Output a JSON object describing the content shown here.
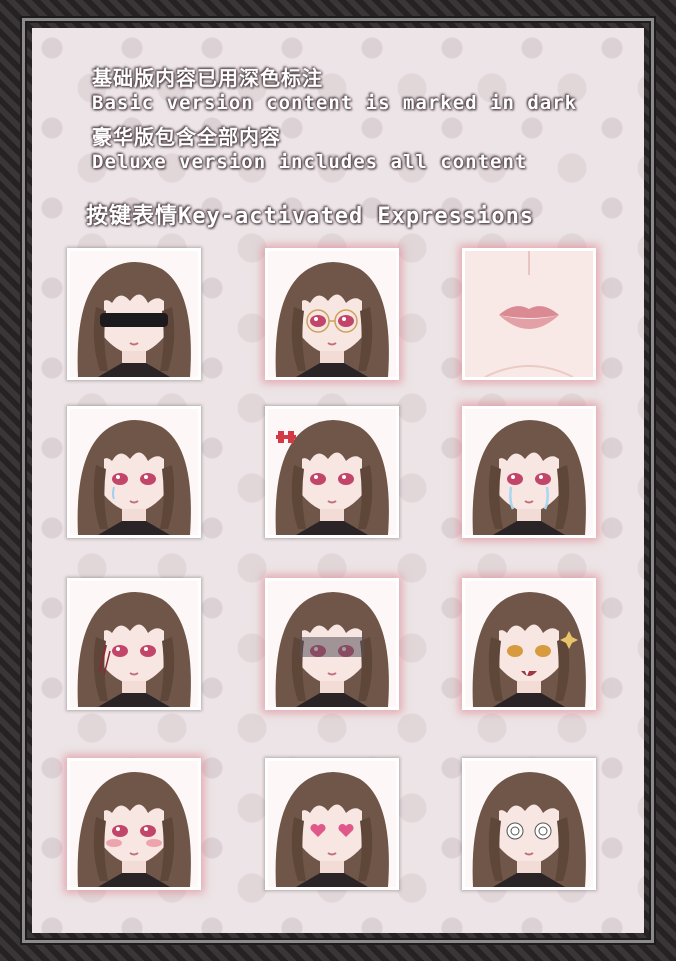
{
  "notes": {
    "basic_cn": "基础版内容已用深色标注",
    "basic_en": "Basic version content is marked in dark",
    "deluxe_cn": "豪华版包含全部内容",
    "deluxe_en": "Deluxe version includes all content"
  },
  "section_title": "按键表情Key-activated Expressions",
  "colors": {
    "panel_bg": "#ece4e6",
    "frame": "#2a2628",
    "hair": "#6f5648",
    "eye": "#c2456a",
    "deluxe_glow": "#dc7882"
  },
  "expressions": [
    {
      "id": "blindfold",
      "version": "basic"
    },
    {
      "id": "glasses",
      "version": "deluxe"
    },
    {
      "id": "lips-closeup",
      "version": "deluxe"
    },
    {
      "id": "teary-eyes",
      "version": "basic"
    },
    {
      "id": "anger-mark",
      "version": "basic"
    },
    {
      "id": "crying",
      "version": "deluxe"
    },
    {
      "id": "scar-face",
      "version": "basic"
    },
    {
      "id": "shadowed-eyes",
      "version": "deluxe"
    },
    {
      "id": "sparkle-fang",
      "version": "deluxe"
    },
    {
      "id": "blush",
      "version": "deluxe"
    },
    {
      "id": "heart-eyes",
      "version": "basic"
    },
    {
      "id": "dizzy-spiral",
      "version": "basic"
    }
  ]
}
